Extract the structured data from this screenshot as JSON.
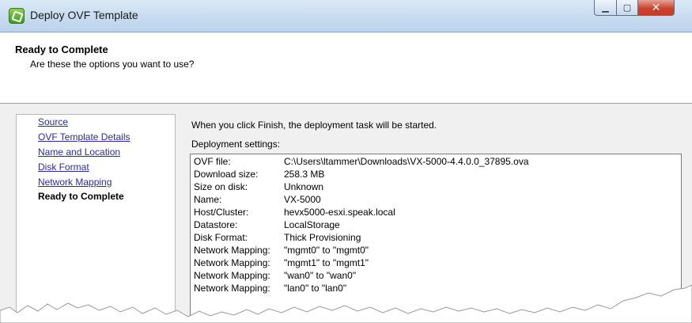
{
  "window": {
    "title": "Deploy OVF Template"
  },
  "header": {
    "title": "Ready to Complete",
    "subtitle": "Are these the options you want to use?"
  },
  "nav": {
    "items": [
      {
        "label": "Source"
      },
      {
        "label": "OVF Template Details"
      },
      {
        "label": "Name and Location"
      },
      {
        "label": "Disk Format"
      },
      {
        "label": "Network Mapping"
      },
      {
        "label": "Ready to Complete"
      }
    ]
  },
  "main": {
    "intro": "When you click Finish, the deployment task will be started.",
    "settings_label": "Deployment settings:",
    "settings": [
      {
        "key": "OVF file:",
        "value": "C:\\Users\\ltammer\\Downloads\\VX-5000-4.4.0.0_37895.ova"
      },
      {
        "key": "Download size:",
        "value": "258.3 MB"
      },
      {
        "key": "Size on disk:",
        "value": "Unknown"
      },
      {
        "key": "Name:",
        "value": "VX-5000"
      },
      {
        "key": "Host/Cluster:",
        "value": "hevx5000-esxi.speak.local"
      },
      {
        "key": "Datastore:",
        "value": "LocalStorage"
      },
      {
        "key": "Disk Format:",
        "value": "Thick Provisioning"
      },
      {
        "key": "Network Mapping:",
        "value": "\"mgmt0\" to \"mgmt0\""
      },
      {
        "key": "Network Mapping:",
        "value": "\"mgmt1\" to \"mgmt1\""
      },
      {
        "key": "Network Mapping:",
        "value": "\"wan0\" to \"wan0\""
      },
      {
        "key": "Network Mapping:",
        "value": "\"lan0\" to \"lan0\""
      }
    ]
  },
  "colors": {
    "link": "#2a2aa8",
    "titlebar": "#c9dcf0",
    "close_button": "#c73b26"
  },
  "icons": [
    "app-icon",
    "minimize-icon",
    "maximize-icon",
    "close-icon"
  ]
}
